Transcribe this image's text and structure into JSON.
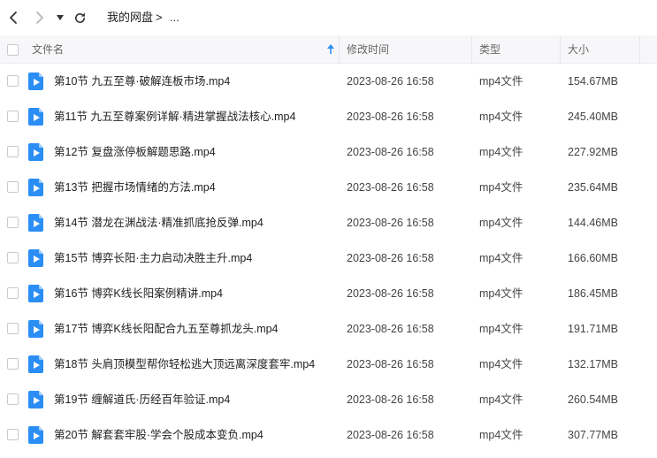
{
  "nav": {
    "breadcrumb": [
      "我的网盘",
      ">",
      "..."
    ]
  },
  "header": {
    "name": "文件名",
    "modified": "修改时间",
    "type": "类型",
    "size": "大小"
  },
  "colors": {
    "accent": "#2b8ef5",
    "header_bg": "#f7f7f9"
  },
  "files": [
    {
      "name": "第10节 九五至尊·破解连板市场.mp4",
      "modified": "2023-08-26 16:58",
      "type": "mp4文件",
      "size": "154.67MB"
    },
    {
      "name": "第11节 九五至尊案例详解·精进掌握战法核心.mp4",
      "modified": "2023-08-26 16:58",
      "type": "mp4文件",
      "size": "245.40MB"
    },
    {
      "name": "第12节 复盘涨停板解题思路.mp4",
      "modified": "2023-08-26 16:58",
      "type": "mp4文件",
      "size": "227.92MB"
    },
    {
      "name": "第13节 把握市场情绪的方法.mp4",
      "modified": "2023-08-26 16:58",
      "type": "mp4文件",
      "size": "235.64MB"
    },
    {
      "name": "第14节 潜龙在渊战法·精准抓底抢反弹.mp4",
      "modified": "2023-08-26 16:58",
      "type": "mp4文件",
      "size": "144.46MB"
    },
    {
      "name": "第15节 博弈长阳·主力启动决胜主升.mp4",
      "modified": "2023-08-26 16:58",
      "type": "mp4文件",
      "size": "166.60MB"
    },
    {
      "name": "第16节 博弈K线长阳案例精讲.mp4",
      "modified": "2023-08-26 16:58",
      "type": "mp4文件",
      "size": "186.45MB"
    },
    {
      "name": "第17节 博弈K线长阳配合九五至尊抓龙头.mp4",
      "modified": "2023-08-26 16:58",
      "type": "mp4文件",
      "size": "191.71MB"
    },
    {
      "name": "第18节 头肩顶模型帮你轻松逃大顶远离深度套牢.mp4",
      "modified": "2023-08-26 16:58",
      "type": "mp4文件",
      "size": "132.17MB"
    },
    {
      "name": "第19节 缠解道氏·历经百年验证.mp4",
      "modified": "2023-08-26 16:58",
      "type": "mp4文件",
      "size": "260.54MB"
    },
    {
      "name": "第20节 解套套牢股·学会个股成本变负.mp4",
      "modified": "2023-08-26 16:58",
      "type": "mp4文件",
      "size": "307.77MB"
    }
  ]
}
